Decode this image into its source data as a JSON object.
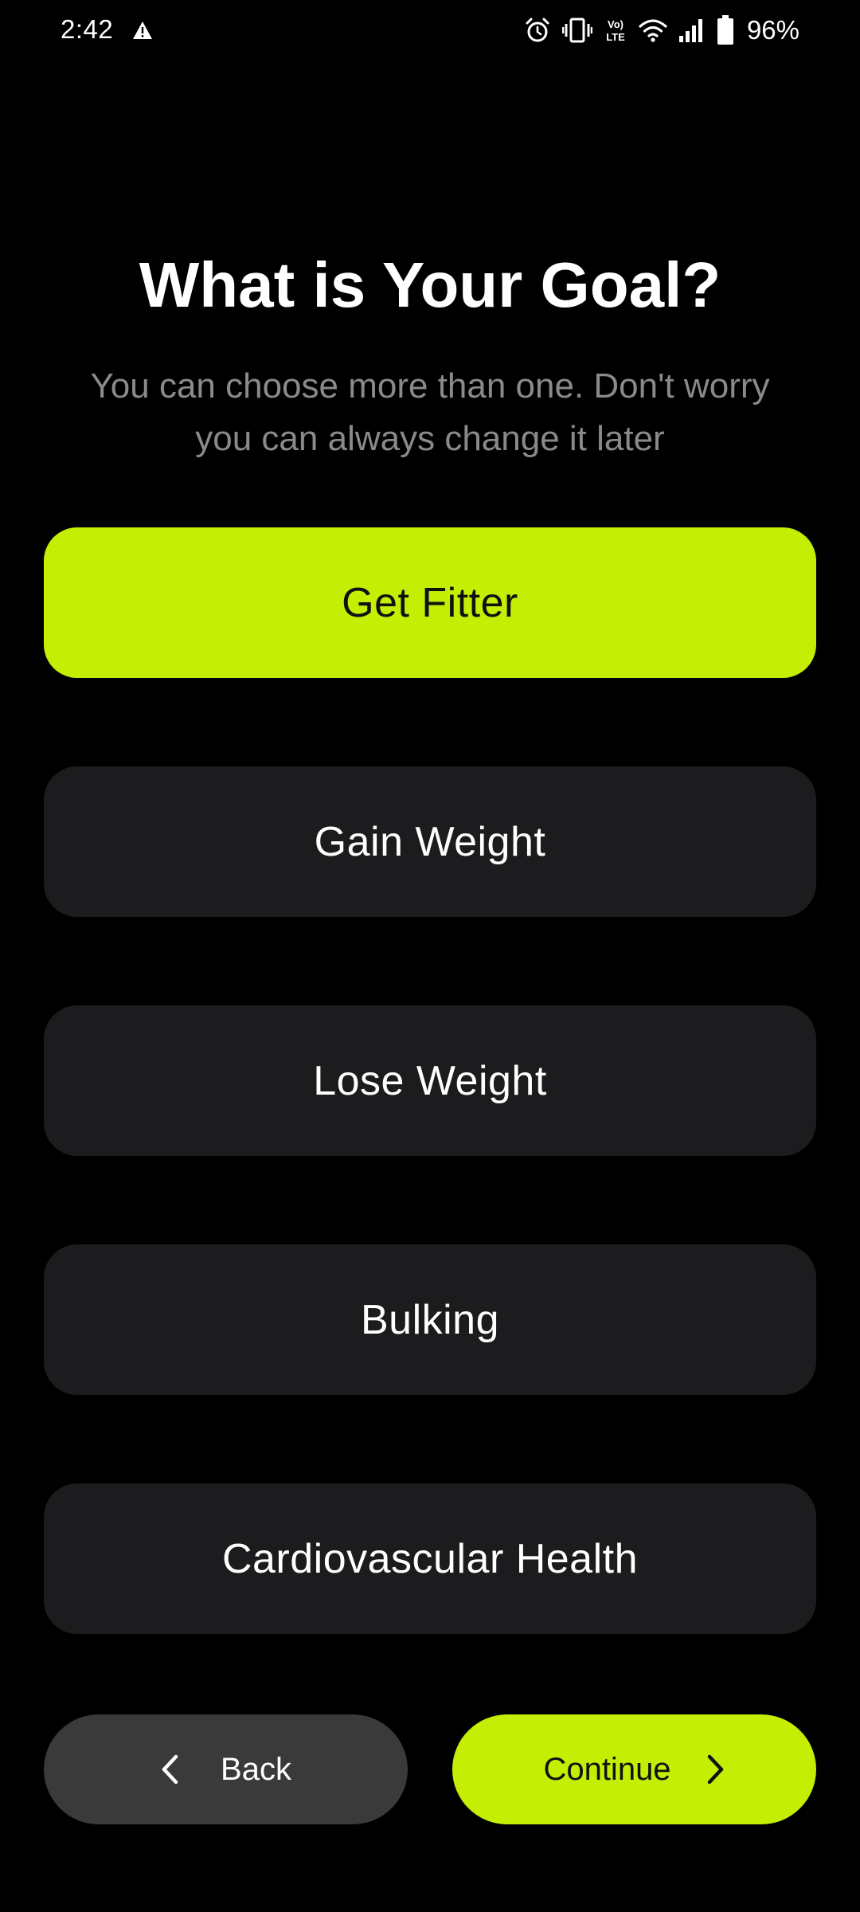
{
  "status_bar": {
    "time": "2:42",
    "battery": "96%"
  },
  "page": {
    "title": "What is Your Goal?",
    "subtitle": "You can choose more than one. Don't worry you can always change it later"
  },
  "goals": [
    {
      "label": "Get Fitter",
      "selected": true
    },
    {
      "label": "Gain Weight",
      "selected": false
    },
    {
      "label": "Lose Weight",
      "selected": false
    },
    {
      "label": "Bulking",
      "selected": false
    },
    {
      "label": "Cardiovascular Health",
      "selected": false
    }
  ],
  "nav": {
    "back_label": "Back",
    "continue_label": "Continue"
  },
  "colors": {
    "accent": "#c5ee05",
    "background": "#000000",
    "option_bg": "#1c1c1e",
    "back_bg": "#3a3a3a",
    "subtitle": "#8a8a8a"
  },
  "icons": {
    "warning": "warning-icon",
    "alarm": "alarm-icon",
    "vibrate": "vibrate-icon",
    "volte": "volte-icon",
    "wifi": "wifi-icon",
    "signal": "signal-icon",
    "battery": "battery-icon",
    "back": "chevron-left-icon",
    "continue": "chevron-right-icon"
  }
}
